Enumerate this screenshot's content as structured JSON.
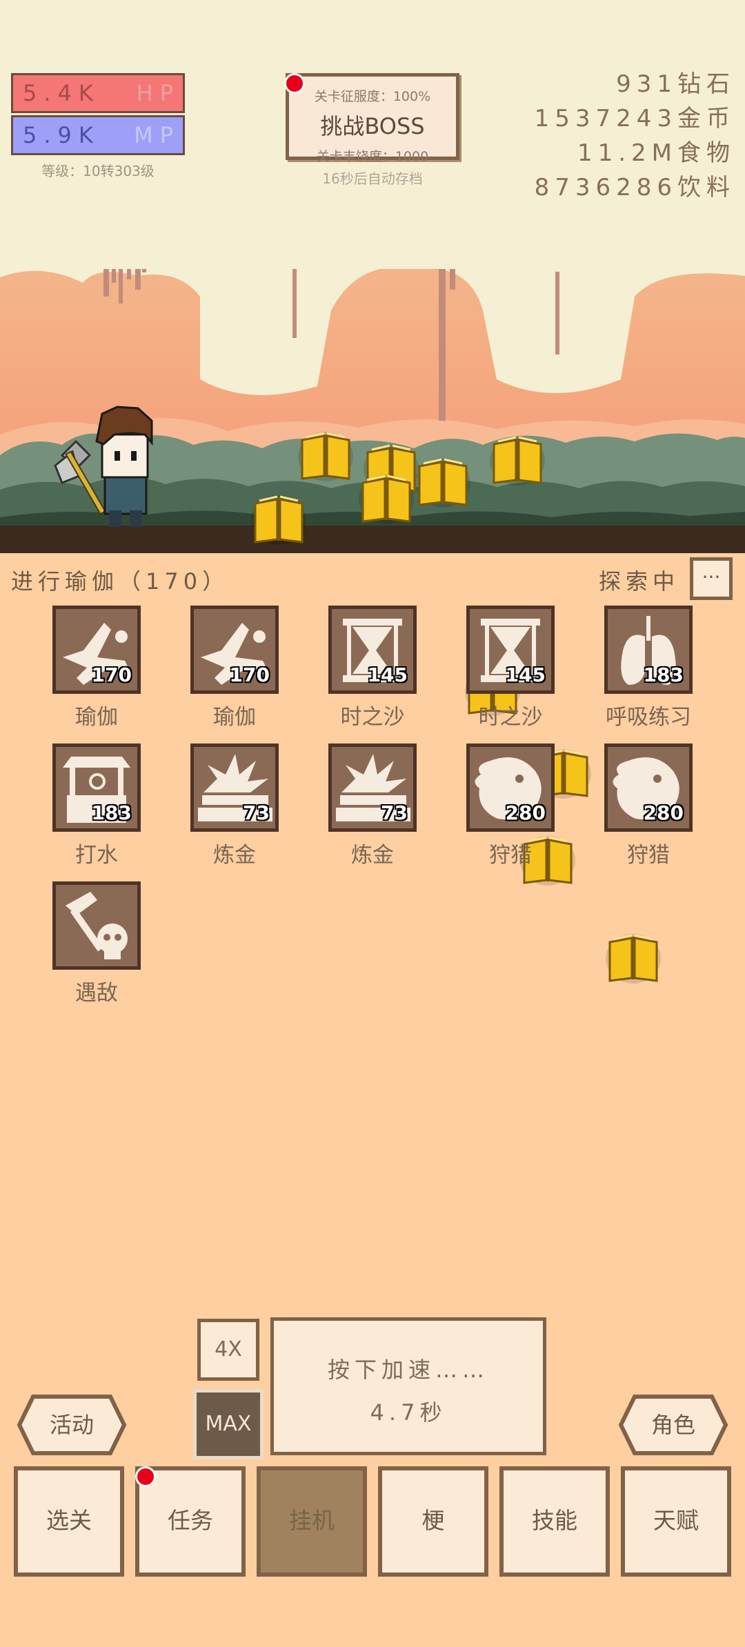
{
  "hud": {
    "hp_value": "5.4K",
    "hp_label": "HP",
    "mp_value": "5.9K",
    "mp_label": "MP",
    "level": "等级：10转303级"
  },
  "boss": {
    "conquest": "关卡征服度：100%",
    "challenge_label": "挑战BOSS",
    "richness": "关卡丰饶度：1000",
    "autosave": "16秒后自动存档"
  },
  "resources": [
    {
      "value": "931",
      "label": "钻石"
    },
    {
      "value": "1537243",
      "label": "金币"
    },
    {
      "value": "11.2M",
      "label": "食物"
    },
    {
      "value": "8736286",
      "label": "饮料"
    }
  ],
  "status": {
    "current_action": "进行瑜伽（170）",
    "exploring": "探索中",
    "more_label": "···"
  },
  "skills": [
    {
      "name": "瑜伽",
      "count": "170",
      "icon": "yoga-icon"
    },
    {
      "name": "瑜伽",
      "count": "170",
      "icon": "yoga-icon"
    },
    {
      "name": "时之沙",
      "count": "145",
      "icon": "hourglass-icon"
    },
    {
      "name": "时之沙",
      "count": "145",
      "icon": "hourglass-icon"
    },
    {
      "name": "呼吸练习",
      "count": "183",
      "icon": "lungs-icon"
    },
    {
      "name": "打水",
      "count": "183",
      "icon": "well-icon"
    },
    {
      "name": "炼金",
      "count": "73",
      "icon": "gold-bars-icon"
    },
    {
      "name": "炼金",
      "count": "73",
      "icon": "gold-bars-icon"
    },
    {
      "name": "狩猎",
      "count": "280",
      "icon": "lion-icon"
    },
    {
      "name": "狩猎",
      "count": "280",
      "icon": "lion-icon"
    },
    {
      "name": "遇敌",
      "count": "",
      "icon": "skull-axe-icon"
    }
  ],
  "speed": {
    "multiplier": "4X",
    "max_label": "MAX",
    "press_hint": "按下加速……",
    "seconds": "4.7秒"
  },
  "side_buttons": {
    "activity": "活动",
    "character": "角色"
  },
  "nav": [
    {
      "label": "选关",
      "active": false
    },
    {
      "label": "任务",
      "active": false,
      "badge": true
    },
    {
      "label": "挂机",
      "active": true
    },
    {
      "label": "梗",
      "active": false
    },
    {
      "label": "技能",
      "active": false
    },
    {
      "label": "天赋",
      "active": false
    }
  ],
  "colors": {
    "hp_bar": "#f47675",
    "mp_bar": "#9e9ff8",
    "panel_bg": "#fecfa1",
    "notification": "#e8001a"
  }
}
